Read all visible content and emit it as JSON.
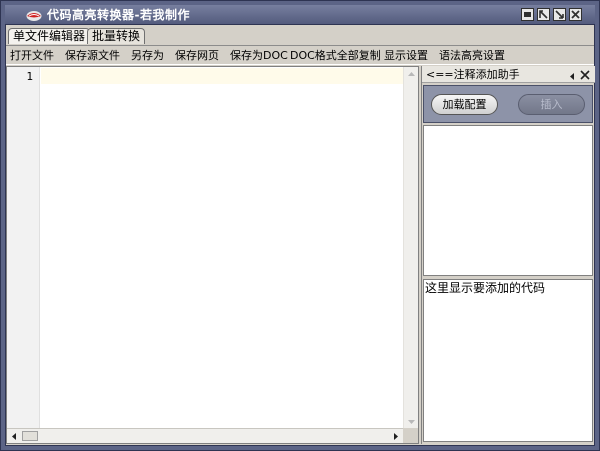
{
  "window": {
    "title": "代码高亮转换器-若我制作",
    "controls": [
      "minimize-icon",
      "restore-icon",
      "maximize-icon",
      "close-icon"
    ]
  },
  "tabs": [
    {
      "label": "单文件编辑器",
      "active": true
    },
    {
      "label": "批量转换",
      "active": false
    }
  ],
  "menu": {
    "items": [
      "打开文件",
      "保存源文件",
      "另存为",
      "保存网页",
      "保存为DOC",
      "DOC格式全部复制",
      "显示设置",
      "语法高亮设置"
    ]
  },
  "editor": {
    "line_numbers": [
      "1"
    ]
  },
  "panel": {
    "title": "<==注释添加助手",
    "load_button": "加载配置",
    "insert_button": "插入",
    "code_hint": "这里显示要添加的代码"
  },
  "colors": {
    "frame": "#5c6486",
    "titlebar": "#606888",
    "current_line": "#fffbea",
    "toolbar_panel": "#8d93a8"
  }
}
